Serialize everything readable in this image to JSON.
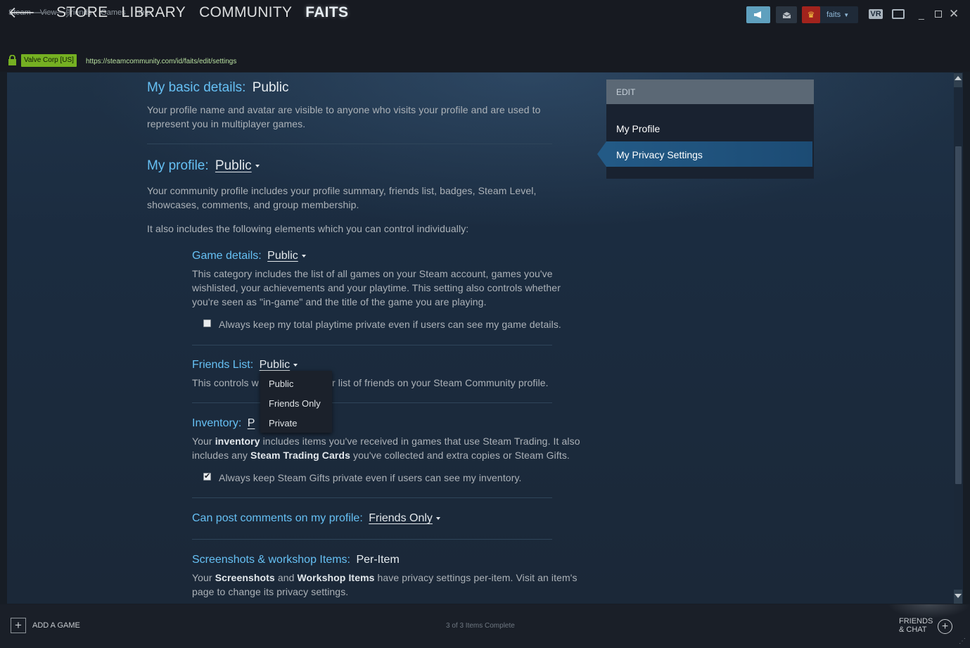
{
  "menu": [
    "Steam",
    "View",
    "Friends",
    "Games",
    "Help"
  ],
  "titlebar": {
    "username": "faits",
    "vr_label": "VR"
  },
  "nav": {
    "tabs": [
      "STORE",
      "LIBRARY",
      "COMMUNITY",
      "FAITS"
    ],
    "active": "FAITS"
  },
  "urlbar": {
    "cert": "Valve Corp [US]",
    "url": "https://steamcommunity.com/id/faits/edit/settings"
  },
  "settings": {
    "basic": {
      "label": "My basic details:",
      "value": "Public",
      "desc": "Your profile name and avatar are visible to anyone who visits your profile and are used to represent you in multiplayer games."
    },
    "profile": {
      "label": "My profile:",
      "value": "Public",
      "desc": "Your community profile includes your profile summary, friends list, badges, Steam Level, showcases, comments, and group membership.",
      "note": "It also includes the following elements which you can control individually:"
    },
    "game_details": {
      "label": "Game details:",
      "value": "Public",
      "desc": "This category includes the list of all games on your Steam account, games you've wishlisted, your achievements and your playtime. This setting also controls whether you're seen as \"in-game\" and the title of the game you are playing.",
      "checkbox_label": "Always keep my total playtime private even if users can see my game details.",
      "checkbox_checked": false
    },
    "friends_list": {
      "label": "Friends List:",
      "value": "Public",
      "desc_start": "This controls w",
      "desc_end": "r list of friends on your Steam Community profile."
    },
    "inventory": {
      "label": "Inventory:",
      "value_partial": "P",
      "desc_parts": [
        "Your ",
        "inventory",
        " includes items you've received in games that use Steam Trading. It also includes any ",
        "Steam Trading Cards",
        " you've collected and extra copies or Steam Gifts."
      ],
      "checkbox_label": "Always keep Steam Gifts private even if users can see my inventory.",
      "checkbox_checked": true
    },
    "comments": {
      "label": "Can post comments on my profile:",
      "value": "Friends Only"
    },
    "screenshots": {
      "label": "Screenshots & workshop Items:",
      "value": "Per-Item",
      "desc_parts": [
        "Your ",
        "Screenshots",
        " and ",
        "Workshop Items",
        " have privacy settings per-item. Visit an item's page to change its privacy settings."
      ]
    }
  },
  "dropdown": {
    "options": [
      "Public",
      "Friends Only",
      "Private"
    ]
  },
  "sidebar": {
    "header": "EDIT",
    "items": [
      "My Profile",
      "My Privacy Settings"
    ],
    "active": "My Privacy Settings"
  },
  "footer": {
    "add_game": "ADD A GAME",
    "status": "3 of 3 Items Complete",
    "friends_chat_line1": "FRIENDS",
    "friends_chat_line2": "& CHAT"
  }
}
